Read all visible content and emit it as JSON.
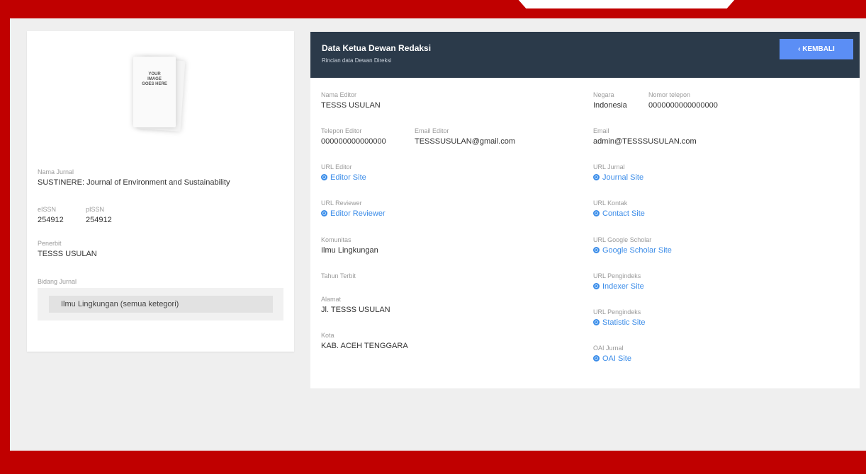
{
  "left": {
    "cover_text": "YOUR IMAGE GOES HERE",
    "nama_jurnal_label": "Nama Jurnal",
    "nama_jurnal_value": "SUSTINERE: Journal of Environment and Sustainability",
    "eissn_label": "eISSN",
    "eissn_value": "254912",
    "pissn_label": "pISSN",
    "pissn_value": "254912",
    "penerbit_label": "Penerbit",
    "penerbit_value": "TESSS USULAN",
    "bidang_label": "Bidang Jurnal",
    "bidang_value": "Ilmu Lingkungan (semua ketegori)"
  },
  "header": {
    "title": "Data Ketua Dewan Redaksi",
    "subtitle": "Rincian data Dewan Direksi",
    "back_label": "‹  KEMBALI"
  },
  "col1": {
    "nama_editor_label": "Nama Editor",
    "nama_editor_value": "TESSS USULAN",
    "telepon_label": "Telepon Editor",
    "telepon_value": "000000000000000",
    "email_editor_label": "Email Editor",
    "email_editor_value": "TESSSUSULAN@gmail.com",
    "url_editor_label": "URL Editor",
    "url_editor_link": "Editor Site",
    "url_reviewer_label": "URL Reviewer",
    "url_reviewer_link": "Editor Reviewer",
    "komunitas_label": "Komunitas",
    "komunitas_value": "Ilmu Lingkungan",
    "tahun_label": "Tahun Terbit",
    "alamat_label": "Alamat",
    "alamat_value": "Jl. TESSS USULAN",
    "kota_label": "Kota",
    "kota_value": "KAB. ACEH TENGGARA"
  },
  "col2": {
    "negara_label": "Negara",
    "negara_value": "Indonesia",
    "nomor_label": "Nomor telepon",
    "nomor_value": "0000000000000000",
    "email_label": "Email",
    "email_value": "admin@TESSSUSULAN.com",
    "url_jurnal_label": "URL Jurnal",
    "url_jurnal_link": "Journal Site",
    "url_kontak_label": "URL Kontak",
    "url_kontak_link": "Contact Site",
    "url_scholar_label": "URL Google Scholar",
    "url_scholar_link": "Google Scholar Site",
    "url_pengindeks_label": "URL Pengindeks",
    "url_pengindeks_link": "Indexer Site",
    "url_pengindeks2_label": "URL Pengindeks",
    "url_pengindeks2_link": "Statistic Site",
    "oai_label": "OAI Jurnal",
    "oai_link": "OAI Site"
  },
  "colors": {
    "frame": "#c00000",
    "header_bg": "#2b3a4a",
    "button": "#5b8ef5",
    "link": "#3b8ce8"
  }
}
